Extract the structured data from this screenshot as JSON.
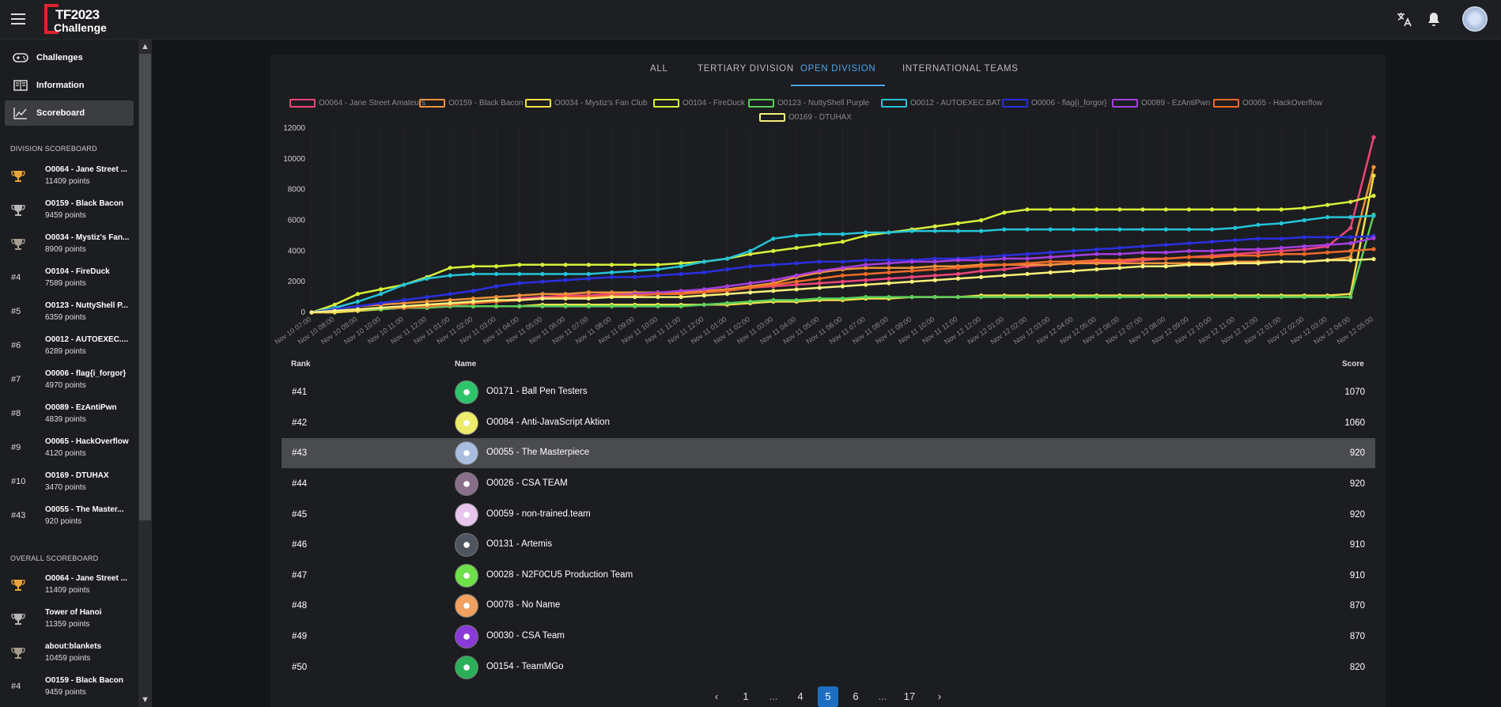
{
  "app": {
    "logo_line1": "TF2023",
    "logo_line2": "Challenge"
  },
  "nav": [
    {
      "label": "Challenges",
      "icon": "gamepad-icon"
    },
    {
      "label": "Information",
      "icon": "book-icon"
    },
    {
      "label": "Scoreboard",
      "icon": "chart-icon"
    }
  ],
  "division_scoreboard": {
    "title": "DIVISION SCOREBOARD",
    "entries": [
      {
        "rank": "",
        "name": "O0064 - Jane Street ...",
        "points": "11409 points",
        "medal": "gold"
      },
      {
        "rank": "",
        "name": "O0159 - Black Bacon",
        "points": "9459 points",
        "medal": "silver"
      },
      {
        "rank": "",
        "name": "O0034 - Mystiz's Fan...",
        "points": "8909 points",
        "medal": "bronze"
      },
      {
        "rank": "#4",
        "name": "O0104 - FireDuck",
        "points": "7589 points"
      },
      {
        "rank": "#5",
        "name": "O0123 - NuttyShell P...",
        "points": "6359 points"
      },
      {
        "rank": "#6",
        "name": "O0012 - AUTOEXEC....",
        "points": "6289 points"
      },
      {
        "rank": "#7",
        "name": "O0006 - flag{i_forgor}",
        "points": "4970 points"
      },
      {
        "rank": "#8",
        "name": "O0089 - EzAntiPwn",
        "points": "4839 points"
      },
      {
        "rank": "#9",
        "name": "O0065 - HackOverflow",
        "points": "4120 points"
      },
      {
        "rank": "#10",
        "name": "O0169 - DTUHAX",
        "points": "3470 points"
      },
      {
        "rank": "#43",
        "name": "O0055 - The Master...",
        "points": "920 points"
      }
    ]
  },
  "overall_scoreboard": {
    "title": "OVERALL SCOREBOARD",
    "entries": [
      {
        "rank": "",
        "name": "O0064 - Jane Street ...",
        "points": "11409 points",
        "medal": "gold"
      },
      {
        "rank": "",
        "name": "Tower of Hanoi",
        "points": "11359 points",
        "medal": "silver"
      },
      {
        "rank": "",
        "name": "about:blankets",
        "points": "10459 points",
        "medal": "bronze"
      },
      {
        "rank": "#4",
        "name": "O0159 - Black Bacon",
        "points": "9459 points"
      }
    ]
  },
  "tabs": [
    {
      "label": "ALL",
      "active": false
    },
    {
      "label": "TERTIARY DIVISION",
      "active": false
    },
    {
      "label": "OPEN DIVISION",
      "active": true
    },
    {
      "label": "INTERNATIONAL TEAMS",
      "active": false
    }
  ],
  "chart_data": {
    "type": "line",
    "ylim": [
      0,
      12000
    ],
    "yticks": [
      "0",
      "2000",
      "4000",
      "6000",
      "8000",
      "10000",
      "12000"
    ],
    "x": [
      "Nov 10 07:00",
      "Nov 10 08:00",
      "Nov 10 09:00",
      "Nov 10 10:00",
      "Nov 10 11:00",
      "Nov 11 12:00",
      "Nov 11 01:00",
      "Nov 11 02:00",
      "Nov 11 03:00",
      "Nov 11 04:00",
      "Nov 11 05:00",
      "Nov 11 06:00",
      "Nov 11 07:00",
      "Nov 11 08:00",
      "Nov 11 09:00",
      "Nov 11 10:00",
      "Nov 11 11:00",
      "Nov 11 12:00",
      "Nov 11 01:00",
      "Nov 11 02:00",
      "Nov 11 03:00",
      "Nov 11 04:00",
      "Nov 11 05:00",
      "Nov 11 06:00",
      "Nov 11 07:00",
      "Nov 11 08:00",
      "Nov 11 09:00",
      "Nov 11 10:00",
      "Nov 11 11:00",
      "Nov 12 12:00",
      "Nov 12 01:00",
      "Nov 12 02:00",
      "Nov 12 03:00",
      "Nov 12 04:00",
      "Nov 12 05:00",
      "Nov 12 06:00",
      "Nov 12 07:00",
      "Nov 12 08:00",
      "Nov 12 09:00",
      "Nov 12 10:00",
      "Nov 12 11:00",
      "Nov 12 12:00",
      "Nov 12 01:00",
      "Nov 12 02:00",
      "Nov 12 03:00",
      "Nov 12 04:00",
      "Nov 12 05:00"
    ],
    "series": [
      {
        "name": "O0064 - Jane Street Amateurs",
        "color": "#f0457a",
        "values": [
          0,
          0,
          100,
          200,
          300,
          300,
          500,
          600,
          700,
          900,
          1000,
          1100,
          1100,
          1200,
          1200,
          1200,
          1200,
          1400,
          1500,
          1600,
          1700,
          1800,
          1900,
          2000,
          2100,
          2200,
          2300,
          2400,
          2500,
          2700,
          2800,
          3000,
          3100,
          3200,
          3300,
          3300,
          3400,
          3500,
          3600,
          3700,
          3800,
          3900,
          4000,
          4100,
          4300,
          5500,
          11409
        ]
      },
      {
        "name": "O0159 - Black Bacon",
        "color": "#f0923a",
        "values": [
          0,
          200,
          400,
          500,
          600,
          700,
          800,
          900,
          1000,
          1100,
          1200,
          1200,
          1300,
          1300,
          1300,
          1300,
          1300,
          1400,
          1500,
          1700,
          1900,
          2300,
          2600,
          2800,
          2900,
          2900,
          2900,
          3000,
          3000,
          3100,
          3100,
          3100,
          3100,
          3200,
          3200,
          3200,
          3200,
          3200,
          3200,
          3200,
          3300,
          3300,
          3300,
          3300,
          3400,
          3600,
          9459
        ]
      },
      {
        "name": "O0034 - Mystiz's Fan Club",
        "color": "#f5e04a",
        "values": [
          0,
          0,
          100,
          200,
          300,
          300,
          400,
          400,
          400,
          400,
          500,
          500,
          500,
          500,
          500,
          500,
          500,
          500,
          500,
          600,
          700,
          700,
          800,
          800,
          900,
          900,
          1000,
          1000,
          1000,
          1100,
          1100,
          1100,
          1100,
          1100,
          1100,
          1100,
          1100,
          1100,
          1100,
          1100,
          1100,
          1100,
          1100,
          1100,
          1100,
          1200,
          8909
        ]
      },
      {
        "name": "O0104 - FireDuck",
        "color": "#d8f03a",
        "values": [
          0,
          500,
          1200,
          1500,
          1800,
          2300,
          2900,
          3000,
          3000,
          3100,
          3100,
          3100,
          3100,
          3100,
          3100,
          3100,
          3200,
          3300,
          3500,
          3800,
          4000,
          4200,
          4400,
          4600,
          5000,
          5200,
          5400,
          5600,
          5800,
          6000,
          6500,
          6700,
          6700,
          6700,
          6700,
          6700,
          6700,
          6700,
          6700,
          6700,
          6700,
          6700,
          6700,
          6800,
          7000,
          7200,
          7589
        ]
      },
      {
        "name": "O0123 - NuttyShell Purple",
        "color": "#5ccf5c",
        "values": [
          0,
          100,
          200,
          200,
          300,
          300,
          400,
          400,
          400,
          400,
          400,
          400,
          400,
          400,
          400,
          400,
          400,
          500,
          600,
          700,
          800,
          800,
          900,
          900,
          1000,
          1000,
          1000,
          1000,
          1000,
          1000,
          1000,
          1000,
          1000,
          1000,
          1000,
          1000,
          1000,
          1000,
          1000,
          1000,
          1000,
          1000,
          1000,
          1000,
          1000,
          1000,
          6359
        ]
      },
      {
        "name": "O0012 - AUTOEXEC.BAT",
        "color": "#25c4d8",
        "values": [
          0,
          300,
          700,
          1200,
          1800,
          2200,
          2400,
          2500,
          2500,
          2500,
          2500,
          2500,
          2500,
          2600,
          2700,
          2800,
          3000,
          3300,
          3500,
          4000,
          4800,
          5000,
          5100,
          5100,
          5200,
          5200,
          5300,
          5300,
          5300,
          5300,
          5400,
          5400,
          5400,
          5400,
          5400,
          5400,
          5400,
          5400,
          5400,
          5400,
          5500,
          5700,
          5800,
          6000,
          6200,
          6200,
          6289
        ]
      },
      {
        "name": "O0006 - flag{i_forgor}",
        "color": "#2b2fe0",
        "values": [
          0,
          200,
          400,
          600,
          800,
          1000,
          1200,
          1400,
          1700,
          1900,
          2000,
          2100,
          2200,
          2300,
          2300,
          2400,
          2500,
          2600,
          2800,
          3000,
          3100,
          3200,
          3300,
          3300,
          3400,
          3400,
          3400,
          3500,
          3500,
          3600,
          3700,
          3800,
          3900,
          4000,
          4100,
          4200,
          4300,
          4400,
          4500,
          4600,
          4700,
          4800,
          4800,
          4900,
          4900,
          4900,
          4970
        ]
      },
      {
        "name": "O0089 - EzAntiPwn",
        "color": "#a53ee0",
        "values": [
          0,
          100,
          200,
          300,
          400,
          400,
          500,
          600,
          700,
          800,
          900,
          900,
          1000,
          1100,
          1200,
          1300,
          1400,
          1500,
          1700,
          1900,
          2100,
          2400,
          2700,
          2900,
          3100,
          3200,
          3300,
          3300,
          3400,
          3400,
          3500,
          3500,
          3600,
          3700,
          3800,
          3800,
          3900,
          3900,
          4000,
          4000,
          4100,
          4100,
          4200,
          4300,
          4400,
          4500,
          4839
        ]
      },
      {
        "name": "O0065 - HackOverflow",
        "color": "#f06a2a",
        "values": [
          0,
          100,
          200,
          300,
          300,
          400,
          500,
          600,
          700,
          800,
          900,
          1000,
          1000,
          1100,
          1100,
          1200,
          1200,
          1300,
          1400,
          1600,
          1800,
          2000,
          2200,
          2400,
          2500,
          2600,
          2700,
          2800,
          2900,
          3000,
          3100,
          3200,
          3300,
          3300,
          3400,
          3400,
          3500,
          3500,
          3600,
          3600,
          3700,
          3700,
          3800,
          3800,
          3900,
          4000,
          4120
        ]
      },
      {
        "name": "O0169 - DTUHAX",
        "color": "#f7f07a",
        "values": [
          0,
          100,
          200,
          300,
          400,
          500,
          600,
          700,
          800,
          800,
          900,
          900,
          900,
          1000,
          1000,
          1000,
          1000,
          1100,
          1200,
          1300,
          1400,
          1500,
          1600,
          1700,
          1800,
          1900,
          2000,
          2100,
          2200,
          2300,
          2400,
          2500,
          2600,
          2700,
          2800,
          2900,
          3000,
          3000,
          3100,
          3100,
          3200,
          3200,
          3300,
          3300,
          3400,
          3400,
          3470
        ]
      }
    ]
  },
  "table": {
    "headers": {
      "rank": "Rank",
      "name": "Name",
      "score": "Score"
    },
    "rows": [
      {
        "rank": "#41",
        "name": "O0171 - Ball Pen Testers",
        "score": "1070",
        "avatar_color": "#2ec46a",
        "highlight": false
      },
      {
        "rank": "#42",
        "name": "O0084 - Anti-JavaScript Aktion",
        "score": "1060",
        "avatar_color": "#ecec6a",
        "highlight": false
      },
      {
        "rank": "#43",
        "name": "O0055 - The Masterpiece",
        "score": "920",
        "avatar_color": "#a9bde0",
        "highlight": true
      },
      {
        "rank": "#44",
        "name": "O0026 - CSA TEAM",
        "score": "920",
        "avatar_color": "#8a6f8a",
        "highlight": false
      },
      {
        "rank": "#45",
        "name": "O0059 - non-trained.team",
        "score": "920",
        "avatar_color": "#e7c5ec",
        "highlight": false
      },
      {
        "rank": "#46",
        "name": "O0131 - Artemis",
        "score": "910",
        "avatar_color": "#4f5560",
        "highlight": false
      },
      {
        "rank": "#47",
        "name": "O0028 - N2F0CU5 Production Team",
        "score": "910",
        "avatar_color": "#6ee04a",
        "highlight": false
      },
      {
        "rank": "#48",
        "name": "O0078 - No Name",
        "score": "870",
        "avatar_color": "#f0a060",
        "highlight": false
      },
      {
        "rank": "#49",
        "name": "O0030 - CSA Team",
        "score": "870",
        "avatar_color": "#8a3ad8",
        "highlight": false
      },
      {
        "rank": "#50",
        "name": "O0154 - TeamMGo",
        "score": "820",
        "avatar_color": "#2bb05a",
        "highlight": false
      }
    ]
  },
  "pagination": {
    "items": [
      {
        "label": "1",
        "active": false
      },
      {
        "label": "...",
        "active": false
      },
      {
        "label": "4",
        "active": false
      },
      {
        "label": "5",
        "active": true
      },
      {
        "label": "6",
        "active": false
      },
      {
        "label": "...",
        "active": false
      },
      {
        "label": "17",
        "active": false
      }
    ]
  }
}
